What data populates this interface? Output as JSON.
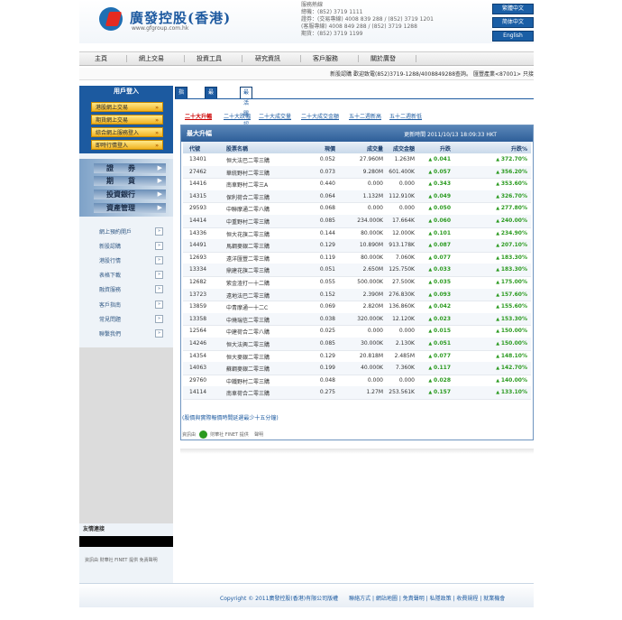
{
  "header": {
    "brand_name": "廣發控股(香港)",
    "brand_url": "www.gfgroup.com.hk",
    "contact": [
      "服務熱線",
      "總機：(852) 3719 1111",
      "證券：(交易專線) 4008 839 288 / (852) 3719 1201",
      "      (客服專線) 4008 849 288 / (852) 3719 1288",
      "期貨：(852) 3719 1199"
    ],
    "lang": [
      "繁體中文",
      "简体中文",
      "English"
    ]
  },
  "nav": [
    "主頁",
    "網上交易",
    "投資工具",
    "研究資訊",
    "客戶服務",
    "關於廣發"
  ],
  "ticker": "新股認購 歡迎致電(852)3719-1288/4008849288查詢。   匯豐產業<87001> 只接",
  "sidebar": {
    "login_title": "用戶登入",
    "login_buttons": [
      "港股網上交易",
      "期貨網上交易",
      "綜合網上服務登入",
      "即時行情登入"
    ],
    "accounts": [
      "證　　券",
      "期　　貨",
      "投資銀行",
      "資產管理"
    ],
    "links": [
      "網上預約開戶",
      "新股認購",
      "港股行情",
      "表格下載",
      "融資服務",
      "客戶指南",
      "常見問題",
      "聯繫我們"
    ],
    "go": "»",
    "friends": "友情連接",
    "finet": "資訊由  財華社 FINET 提供   免責聲明"
  },
  "tabs": [
    "指數報價",
    "最活躍股票",
    "最活躍認股證"
  ],
  "subnav": [
    "二十大升幅",
    "二十大跌幅",
    "二十大成交量",
    "二十大成交金額",
    "五十二週新高",
    "五十二週新低"
  ],
  "table": {
    "title": "最大升幅",
    "update_time": "更新時間 2011/10/13 18:09:33 HKT",
    "headers": {
      "code": "代號",
      "name": "股票名稱",
      "price": "現價",
      "volume": "成交量",
      "amount": "成交金額",
      "change": "升跌",
      "pct": "升跌%"
    },
    "rows": [
      {
        "code": "13401",
        "name": "恒大法巴二零三購",
        "price": "0.052",
        "volume": "27.960M",
        "amount": "1.263M",
        "change": "0.041",
        "pct": "372.70%"
      },
      {
        "code": "27462",
        "name": "華統野村二零三購",
        "price": "0.073",
        "volume": "9.280M",
        "amount": "601.400K",
        "change": "0.057",
        "pct": "356.20%"
      },
      {
        "code": "14416",
        "name": "南車野村二零三A",
        "price": "0.440",
        "volume": "0.000",
        "amount": "0.000",
        "change": "0.343",
        "pct": "353.60%"
      },
      {
        "code": "14315",
        "name": "保利荷合二零三購",
        "price": "0.064",
        "volume": "1.132M",
        "amount": "112.910K",
        "change": "0.049",
        "pct": "326.70%"
      },
      {
        "code": "29593",
        "name": "中聯摩通二零八購",
        "price": "0.068",
        "volume": "0.000",
        "amount": "0.000",
        "change": "0.050",
        "pct": "277.80%"
      },
      {
        "code": "14414",
        "name": "中重野村二零三購",
        "price": "0.085",
        "volume": "234.000K",
        "amount": "17.664K",
        "change": "0.060",
        "pct": "240.00%"
      },
      {
        "code": "14336",
        "name": "恒大花旗二零三購",
        "price": "0.144",
        "volume": "80.000K",
        "amount": "12.000K",
        "change": "0.101",
        "pct": "234.90%"
      },
      {
        "code": "14491",
        "name": "馬鋼麥銀二零三購",
        "price": "0.129",
        "volume": "10.890M",
        "amount": "913.178K",
        "change": "0.087",
        "pct": "207.10%"
      },
      {
        "code": "12693",
        "name": "遠洋匯豐二零三購",
        "price": "0.119",
        "volume": "80.000K",
        "amount": "7.060K",
        "change": "0.077",
        "pct": "183.30%"
      },
      {
        "code": "13334",
        "name": "鼎建花旗二零三購",
        "price": "0.051",
        "volume": "2.650M",
        "amount": "125.750K",
        "change": "0.033",
        "pct": "183.30%"
      },
      {
        "code": "12682",
        "name": "紫金渣打一十二購",
        "price": "0.055",
        "volume": "500.000K",
        "amount": "27.500K",
        "change": "0.035",
        "pct": "175.00%"
      },
      {
        "code": "13723",
        "name": "遠地法巴二零三購",
        "price": "0.152",
        "volume": "2.390M",
        "amount": "276.830K",
        "change": "0.093",
        "pct": "157.60%"
      },
      {
        "code": "13859",
        "name": "中青摩通一十二C",
        "price": "0.069",
        "volume": "2.820M",
        "amount": "136.860K",
        "change": "0.042",
        "pct": "155.60%"
      },
      {
        "code": "13358",
        "name": "中燒瑞信二零三購",
        "price": "0.038",
        "volume": "320.000K",
        "amount": "12.120K",
        "change": "0.023",
        "pct": "153.30%"
      },
      {
        "code": "12564",
        "name": "中建荷合二零八購",
        "price": "0.025",
        "volume": "0.000",
        "amount": "0.000",
        "change": "0.015",
        "pct": "150.00%"
      },
      {
        "code": "14246",
        "name": "恒大法興二零三購",
        "price": "0.085",
        "volume": "30.000K",
        "amount": "2.130K",
        "change": "0.051",
        "pct": "150.00%"
      },
      {
        "code": "14354",
        "name": "恒大麥銀二零三購",
        "price": "0.129",
        "volume": "20.818M",
        "amount": "2.485M",
        "change": "0.077",
        "pct": "148.10%"
      },
      {
        "code": "14063",
        "name": "蘇鋼麥銀二零三購",
        "price": "0.199",
        "volume": "40.000K",
        "amount": "7.360K",
        "change": "0.117",
        "pct": "142.70%"
      },
      {
        "code": "29760",
        "name": "中鐵野村二零三購",
        "price": "0.048",
        "volume": "0.000",
        "amount": "0.000",
        "change": "0.028",
        "pct": "140.00%"
      },
      {
        "code": "14114",
        "name": "南車荷合二零三購",
        "price": "0.275",
        "volume": "1.27M",
        "amount": "253.561K",
        "change": "0.157",
        "pct": "133.10%"
      }
    ]
  },
  "note": "(股價與實際報價時間延遲最少十五分鐘)",
  "finet_main": {
    "prefix": "資訊由",
    "provider": "財華社 FINET",
    "suffix": "提供",
    "disclaimer": "聲明"
  },
  "footer": "Copyright © 2011廣發控股(香港)有限公司版權　　聯絡方式 | 網站地圖 | 免責聲明 | 私隱政策 | 收費規程 | 就業機會",
  "colors": {
    "brand_blue": "#1c5aa0",
    "up_green": "#2a9a1f",
    "logo_red": "#e42a20"
  }
}
